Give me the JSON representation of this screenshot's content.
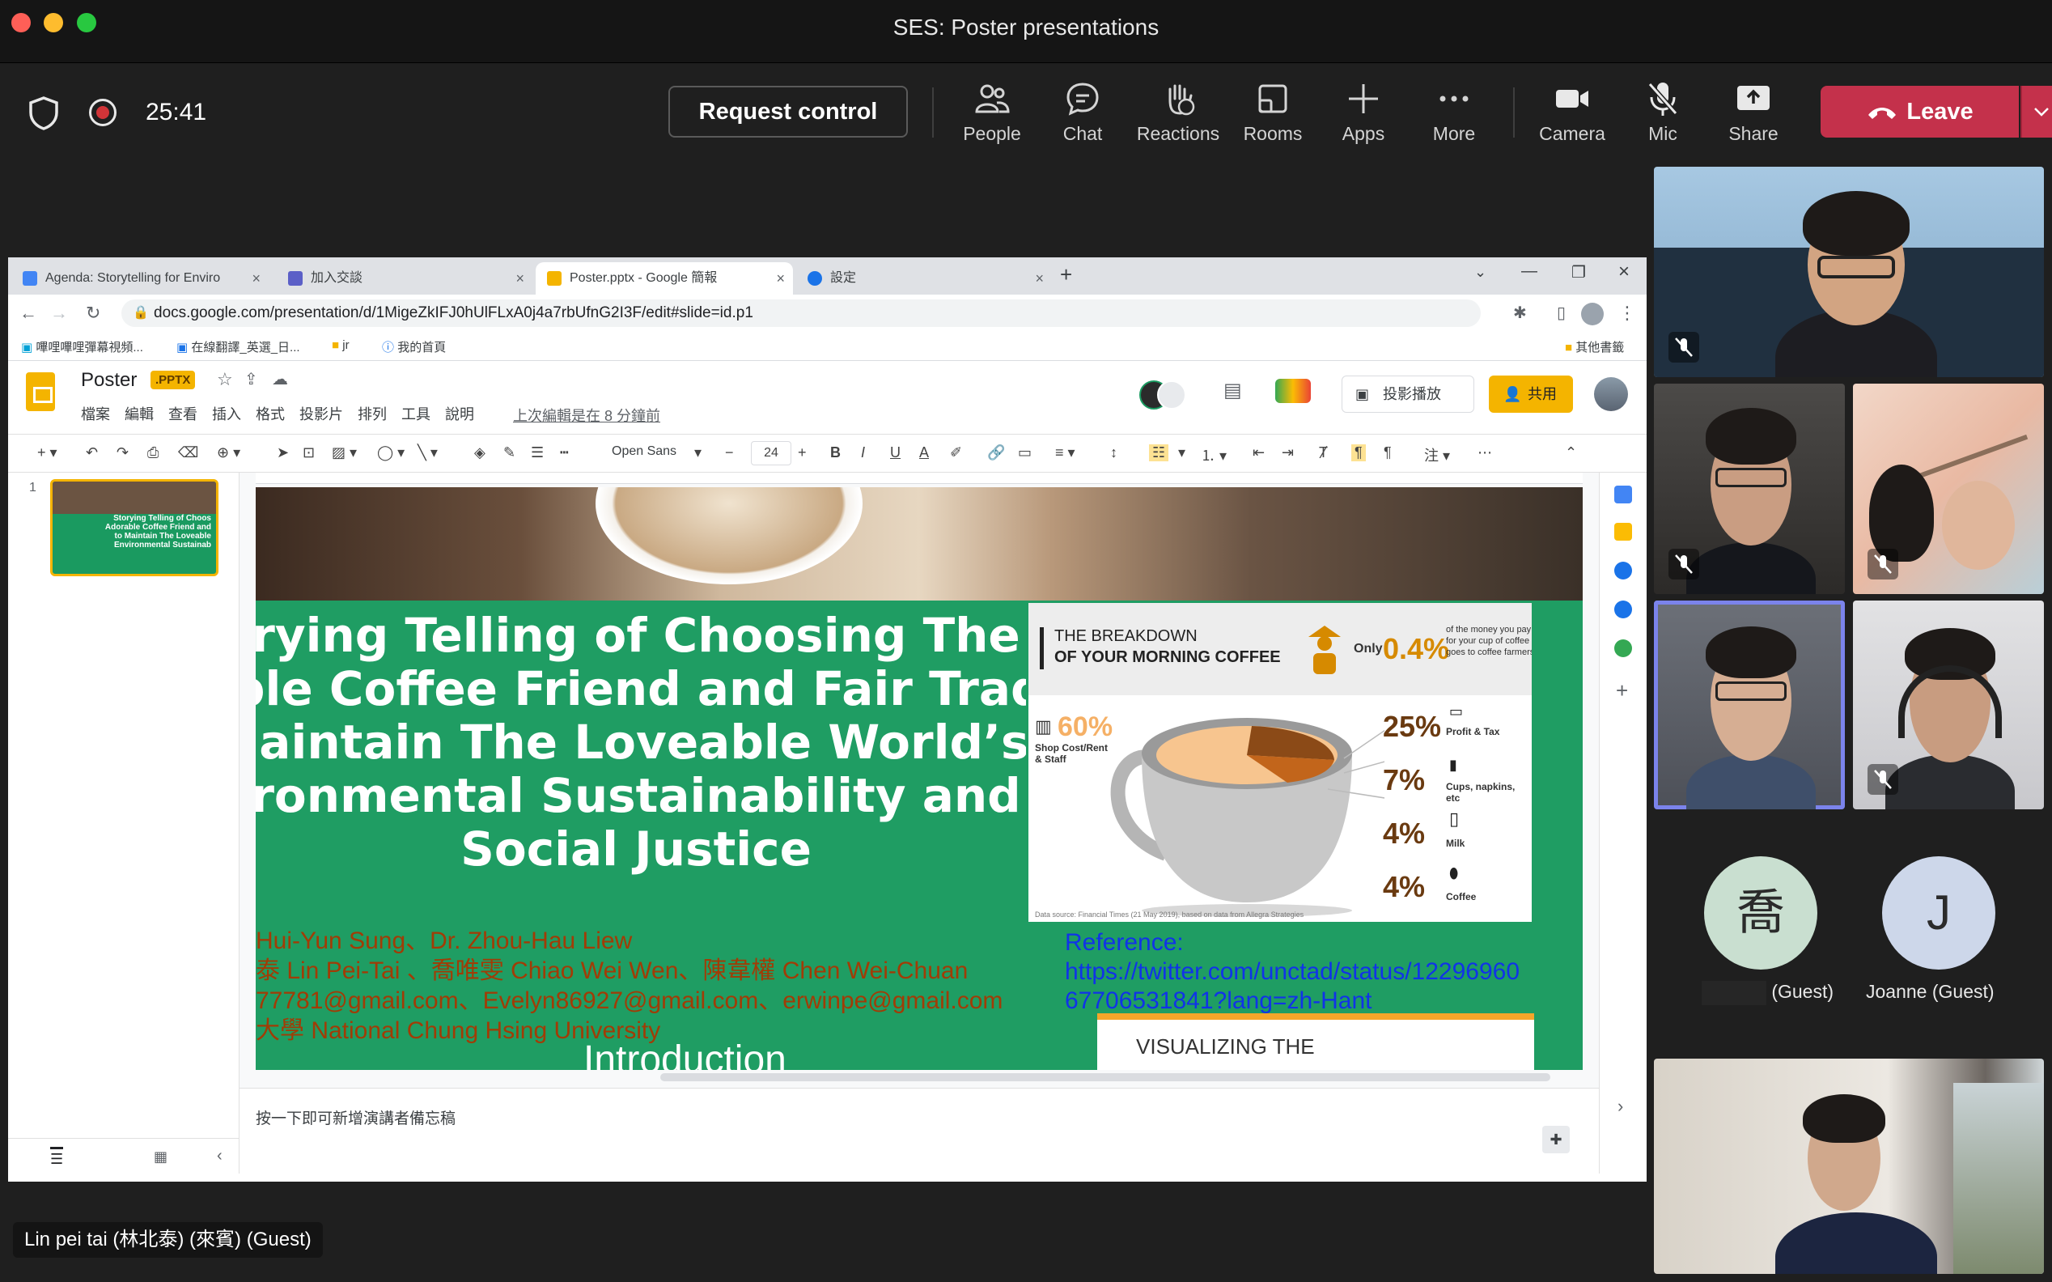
{
  "window": {
    "title": "SES: Poster presentations"
  },
  "meeting": {
    "timer": "25:41",
    "request_control_label": "Request control",
    "buttons": {
      "people": "People",
      "chat": "Chat",
      "reactions": "Reactions",
      "rooms": "Rooms",
      "apps": "Apps",
      "more": "More",
      "camera": "Camera",
      "mic": "Mic",
      "share": "Share"
    },
    "leave_label": "Leave",
    "accent_color": "#c4314b"
  },
  "browser": {
    "tabs": [
      {
        "label": "Agenda: Storytelling for Enviro",
        "active": false
      },
      {
        "label": "加入交談",
        "active": false
      },
      {
        "label": "Poster.pptx - Google 簡報",
        "active": true
      },
      {
        "label": "設定",
        "active": false
      }
    ],
    "url": "docs.google.com/presentation/d/1MigeZkIFJ0hUlFLxA0j4a7rbUfnG2I3F/edit#slide=id.p1",
    "bookmarks": [
      "嗶哩嗶哩彈幕視頻...",
      "在線翻譯_英選_日...",
      "jr",
      "我的首頁"
    ],
    "other_bookmarks": "其他書籤"
  },
  "slides_app": {
    "doc_title": "Poster",
    "badge": ".PPTX",
    "menus": [
      "檔案",
      "編輯",
      "查看",
      "插入",
      "格式",
      "投影片",
      "排列",
      "工具",
      "說明"
    ],
    "last_edit": "上次編輯是在 8 分鐘前",
    "present_label": "投影播放",
    "share_label": "共用",
    "font_name": "Open Sans",
    "font_size": "24",
    "slide_number": "1",
    "notes_placeholder": "按一下即可新增演講者備忘稿"
  },
  "poster": {
    "title_lines": [
      "rying Telling of Choosing The",
      "ble Coffee Friend and Fair Trade",
      "laintain The Loveable World’s",
      "ronmental Sustainability and",
      "Social Justice"
    ],
    "author_lines": [
      "Hui-Yun Sung、Dr. Zhou-Hau Liew",
      "泰 Lin Pei-Tai 、喬唯雯 Chiao Wei Wen、陳韋權 Chen Wei-Chuan",
      "77781@gmail.com、Evelyn86927@gmail.com、erwinpe@gmail.com",
      "大學 National Chung Hsing University"
    ],
    "intro_heading": "Introduction",
    "thumb_text": [
      "Storying Telling of Choos",
      "Adorable Coffee Friend and",
      "to Maintain The Loveable",
      "Environmental Sustainab"
    ],
    "infographic": {
      "title_line1": "THE BREAKDOWN",
      "title_line2": "OF YOUR MORNING COFFEE",
      "only_label": "Only",
      "only_pct": "0.4%",
      "only_note": "of the money you pay for your cup of coffee goes to coffee farmers",
      "shop_pct": "60%",
      "shop_label": "Shop Cost/Rent & Staff",
      "items": [
        {
          "pct": "25%",
          "label": "Profit & Tax"
        },
        {
          "pct": "7%",
          "label": "Cups, napkins, etc"
        },
        {
          "pct": "4%",
          "label": "Milk"
        },
        {
          "pct": "4%",
          "label": "Coffee"
        }
      ],
      "source": "Data source: Financial Times (21 May 2019), based on data from Allegra Strategies"
    },
    "reference_lines": [
      "Reference:",
      "https://twitter.com/unctad/status/12296960",
      "67706531841?lang=zh-Hant"
    ],
    "visualizing_text": "VISUALIZING THE"
  },
  "participants": {
    "guest1_initial": "喬",
    "guest1_name": "(Guest)",
    "guest2_initial": "J",
    "guest2_name": "Joanne (Guest)",
    "guest1_color": "#c9dfd0",
    "guest2_color": "#cdd7ea"
  },
  "speaker_label": "Lin pei tai (林北泰) (來賓) (Guest)"
}
